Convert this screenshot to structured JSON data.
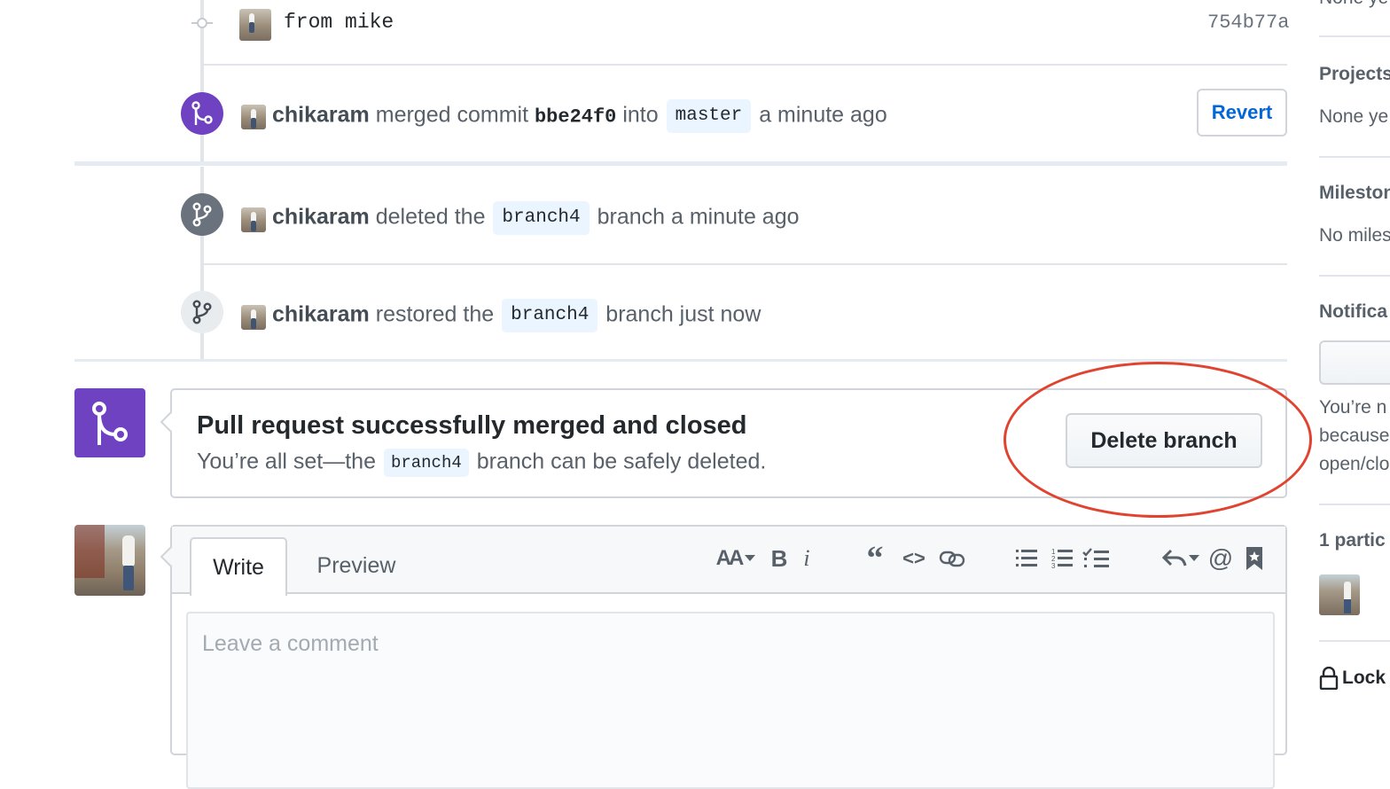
{
  "commit": {
    "message": "from mike",
    "sha": "754b77a"
  },
  "events": [
    {
      "author": "chikaram",
      "text1": "merged commit",
      "sha": "bbe24f0",
      "text2": "into",
      "branch": "master",
      "time": "a minute ago"
    },
    {
      "author": "chikaram",
      "text1": "deleted the",
      "branch": "branch4",
      "text2": "branch a minute ago"
    },
    {
      "author": "chikaram",
      "text1": "restored the",
      "branch": "branch4",
      "text2": "branch just now"
    }
  ],
  "revert_label": "Revert",
  "merged": {
    "title": "Pull request successfully merged and closed",
    "desc_before": "You’re all set—the",
    "branch": "branch4",
    "desc_after": "branch can be safely deleted.",
    "delete_label": "Delete branch"
  },
  "comment": {
    "tab_write": "Write",
    "tab_preview": "Preview",
    "placeholder": "Leave a comment",
    "toolbar": {
      "header": "AA",
      "bold": "B",
      "italic": "i",
      "quote": "“",
      "code": "<>",
      "mention": "@"
    }
  },
  "sidebar": {
    "top_text": "None ye",
    "projects_heading": "Projects",
    "projects_value": "None ye",
    "milestone_heading": "Milestone",
    "milestone_value": "No miles",
    "notifications_heading": "Notifica",
    "notif_line1": "You’re n",
    "notif_line2": "because",
    "notif_line3": "open/clo",
    "participants": "1 partic",
    "lock": "Lock"
  },
  "colors": {
    "merged_purple": "#6f42c1",
    "link_blue": "#0366d6",
    "annotation_red": "#e0432f"
  }
}
